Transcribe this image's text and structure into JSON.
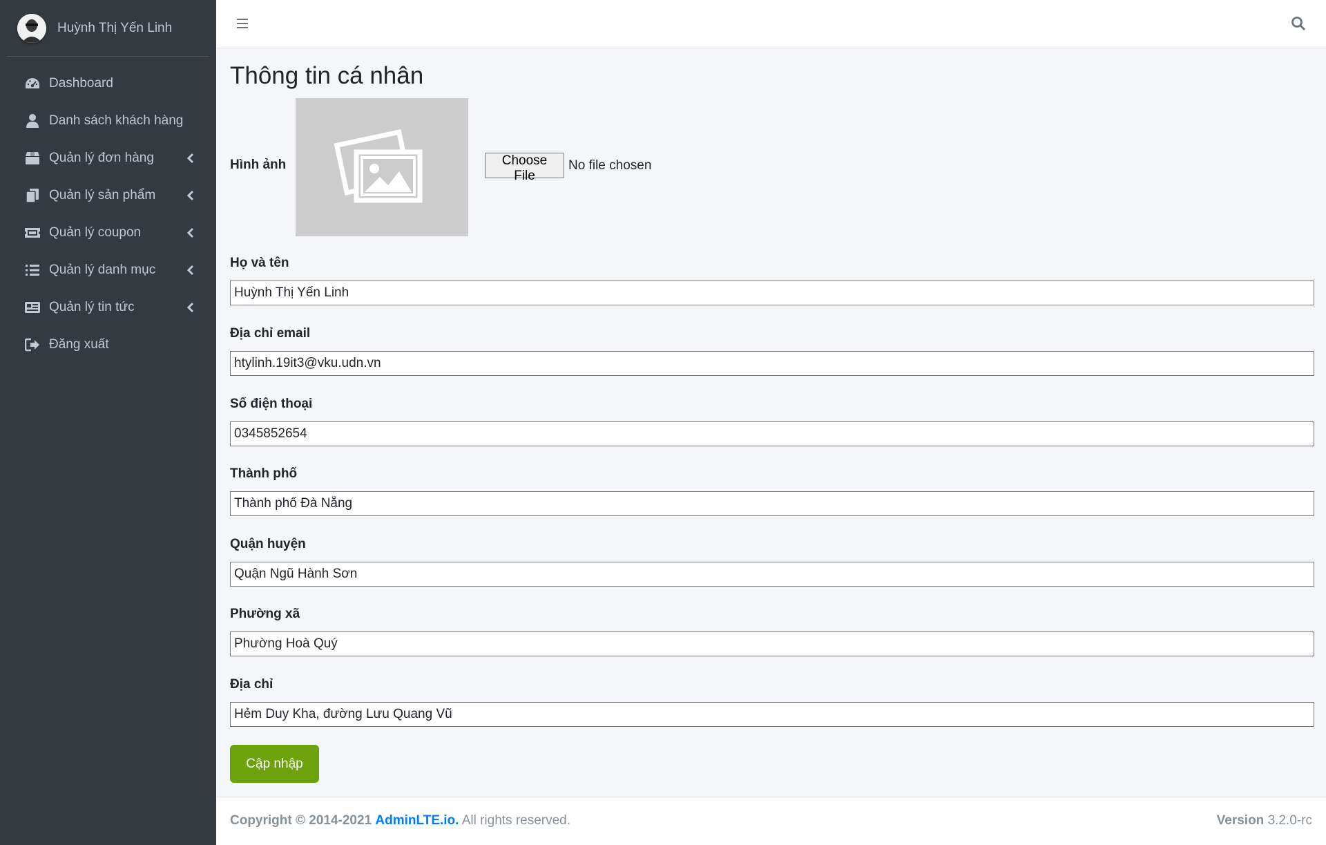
{
  "sidebar": {
    "user_name": "Huỳnh Thị Yến Linh",
    "items": [
      {
        "label": "Dashboard",
        "icon": "tachometer-icon"
      },
      {
        "label": "Danh sách khách hàng",
        "icon": "user-icon"
      },
      {
        "label": "Quản lý đơn hàng",
        "icon": "box-icon",
        "caret": true
      },
      {
        "label": "Quản lý sản phẩm",
        "icon": "copy-icon",
        "caret": true
      },
      {
        "label": "Quản lý coupon",
        "icon": "ticket-icon",
        "caret": true
      },
      {
        "label": "Quản lý danh mục",
        "icon": "list-icon",
        "caret": true
      },
      {
        "label": "Quản lý tin tức",
        "icon": "newspaper-icon",
        "caret": true
      },
      {
        "label": "Đăng xuất",
        "icon": "sign-out-icon"
      }
    ]
  },
  "header": {
    "menu_icon": "bars-icon",
    "search_icon": "search-icon"
  },
  "main": {
    "title": "Thông tin cá nhân",
    "image": {
      "label": "Hình ảnh",
      "button": "Choose File",
      "status": "No file chosen"
    },
    "fields": [
      {
        "label": "Họ và tên",
        "value": "Huỳnh Thị Yến Linh"
      },
      {
        "label": "Địa chỉ email",
        "value": "htylinh.19it3@vku.udn.vn"
      },
      {
        "label": "Số điện thoại",
        "value": "0345852654"
      },
      {
        "label": "Thành phố",
        "value": "Thành phố Đà Nẵng"
      },
      {
        "label": "Quận huyện",
        "value": "Quận Ngũ Hành Sơn"
      },
      {
        "label": "Phường xã",
        "value": "Phường Hoà Quý"
      },
      {
        "label": "Địa chỉ",
        "value": "Hẻm Duy Kha, đường Lưu Quang Vũ"
      }
    ],
    "submit": "Cập nhập"
  },
  "footer": {
    "copyright": "Copyright © 2014-2021",
    "brand": "AdminLTE.io.",
    "rights": "All rights reserved.",
    "version_label": "Version",
    "version": "3.2.0-rc"
  },
  "colors": {
    "sidebar_bg": "#343a40",
    "accent_button": "#6ea20d",
    "link": "#007bff"
  }
}
